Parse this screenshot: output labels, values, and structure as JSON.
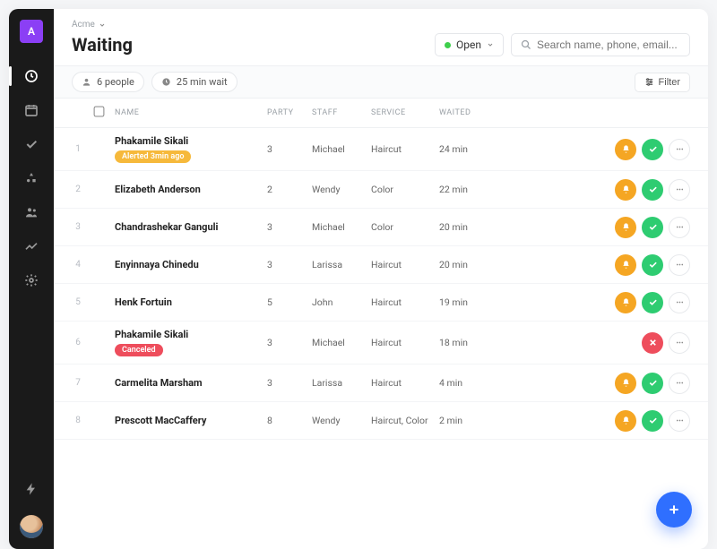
{
  "logo_letter": "A",
  "breadcrumb": {
    "org": "Acme"
  },
  "page_title": "Waiting",
  "status": {
    "label": "Open"
  },
  "search": {
    "placeholder": "Search name, phone, email..."
  },
  "toolbar": {
    "people_chip": "6 people",
    "wait_chip": "25 min wait",
    "filter_label": "Filter"
  },
  "columns": {
    "name": "NAME",
    "party": "PARTY",
    "staff": "STAFF",
    "service": "SERVICE",
    "waited": "WAITED"
  },
  "rows": [
    {
      "num": "1",
      "name": "Phakamile Sikali",
      "badge": "Alerted 3min ago",
      "badge_type": "alerted",
      "party": "3",
      "staff": "Michael",
      "service": "Haircut",
      "waited": "24 min",
      "actions": "full"
    },
    {
      "num": "2",
      "name": "Elizabeth Anderson",
      "party": "2",
      "staff": "Wendy",
      "service": "Color",
      "waited": "22 min",
      "actions": "full"
    },
    {
      "num": "3",
      "name": "Chandrashekar Ganguli",
      "party": "3",
      "staff": "Michael",
      "service": "Color",
      "waited": "20 min",
      "actions": "full"
    },
    {
      "num": "4",
      "name": "Enyinnaya Chinedu",
      "party": "3",
      "staff": "Larissa",
      "service": "Haircut",
      "waited": "20 min",
      "actions": "full"
    },
    {
      "num": "5",
      "name": "Henk Fortuin",
      "party": "5",
      "staff": "John",
      "service": "Haircut",
      "waited": "19 min",
      "actions": "full"
    },
    {
      "num": "6",
      "name": "Phakamile Sikali",
      "badge": "Canceled",
      "badge_type": "canceled",
      "party": "3",
      "staff": "Michael",
      "service": "Haircut",
      "waited": "18 min",
      "actions": "cancel"
    },
    {
      "num": "7",
      "name": "Carmelita Marsham",
      "party": "3",
      "staff": "Larissa",
      "service": "Haircut",
      "waited": "4 min",
      "actions": "full"
    },
    {
      "num": "8",
      "name": "Prescott MacCaffery",
      "party": "8",
      "staff": "Wendy",
      "service": "Haircut, Color",
      "waited": "2 min",
      "actions": "full"
    }
  ]
}
